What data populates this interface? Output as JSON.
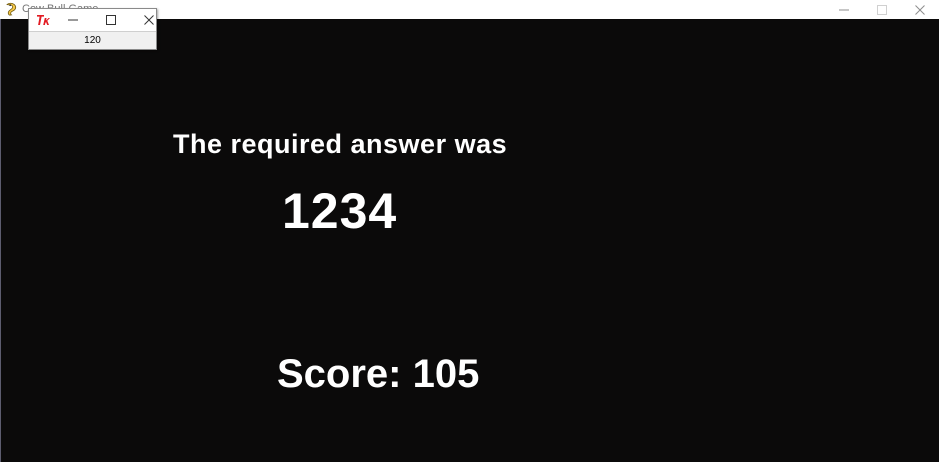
{
  "main_window": {
    "title": "Cow Bull Game",
    "icon": "pygame-snake-icon",
    "controls": {
      "minimize_icon": "minimize-icon",
      "maximize_icon": "maximize-icon",
      "close_icon": "close-icon"
    }
  },
  "game": {
    "heading": "The required answer was",
    "answer": "1234",
    "score_text": "Score: 105"
  },
  "tk_window": {
    "icon": "tk-feather-icon",
    "label": "120",
    "controls": {
      "minimize_icon": "minimize-icon",
      "maximize_icon": "maximize-icon",
      "close_icon": "close-icon"
    }
  },
  "colors": {
    "canvas_background": "#0b0a0a",
    "text": "#ffffff",
    "tk_body": "#f0f0f0",
    "tk_icon": "#e21b23"
  }
}
